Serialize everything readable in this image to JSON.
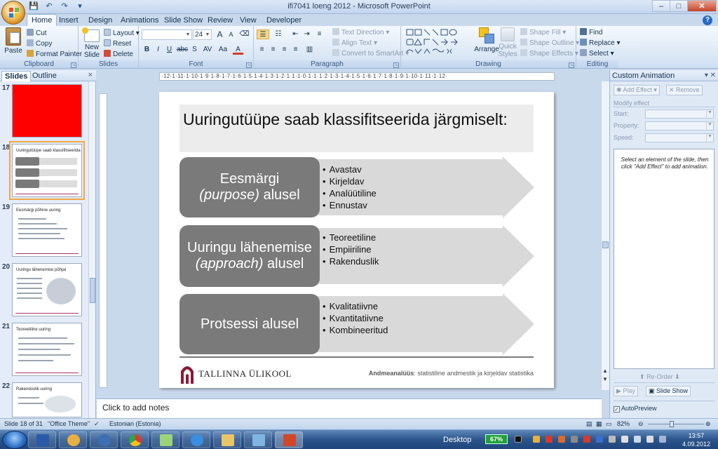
{
  "window": {
    "title": "ifi7041 loeng 2012 - Microsoft PowerPoint",
    "min": "–",
    "max": "□",
    "close": "✕"
  },
  "qat": {
    "save": "💾",
    "undo": "↶",
    "redo": "↷",
    "more": "▾"
  },
  "tabs": [
    "Home",
    "Insert",
    "Design",
    "Animations",
    "Slide Show",
    "Review",
    "View",
    "Developer"
  ],
  "active_tab": "Home",
  "ribbon": {
    "clipboard": {
      "label": "Clipboard",
      "paste": "Paste",
      "cut": "Cut",
      "copy": "Copy",
      "format_painter": "Format Painter"
    },
    "slides": {
      "label": "Slides",
      "new_slide": "New Slide",
      "layout": "Layout",
      "reset": "Reset",
      "delete": "Delete"
    },
    "font": {
      "label": "Font",
      "font_name": "",
      "font_size": "24",
      "grow": "A",
      "shrink": "A",
      "clear": "⌫",
      "bold": "B",
      "italic": "I",
      "underline": "U",
      "strike": "abc",
      "shadow": "S",
      "spacing": "AV",
      "case": "Aa",
      "color": "A"
    },
    "paragraph": {
      "label": "Paragraph",
      "text_direction": "Text Direction",
      "align_text": "Align Text",
      "convert_smartart": "Convert to SmartArt"
    },
    "drawing": {
      "label": "Drawing",
      "arrange": "Arrange",
      "quick_styles": "Quick Styles",
      "shape_fill": "Shape Fill",
      "shape_outline": "Shape Outline",
      "shape_effects": "Shape Effects"
    },
    "editing": {
      "label": "Editing",
      "find": "Find",
      "replace": "Replace",
      "select": "Select"
    }
  },
  "left_panel": {
    "tabs": [
      "Slides",
      "Outline"
    ],
    "close": "×",
    "thumbnails": [
      {
        "num": "17",
        "title": ""
      },
      {
        "num": "18",
        "title": "Uuringutüüpe saab klassifitseerida"
      },
      {
        "num": "19",
        "title": "Eesmärgi põhine uuring"
      },
      {
        "num": "20",
        "title": "Uuringu lähenemise põhjal"
      },
      {
        "num": "21",
        "title": "Teoreetiline uuring"
      },
      {
        "num": "22",
        "title": "Rakenduslik uuring"
      }
    ]
  },
  "ruler": {
    "h": "·12·1·11·1·10·1·9·1·8·1·7·1·6·1·5·1·4·1·3·1·2·1·1·1·0·1·1·1·2·1·3·1·4·1·5·1·6·1·7·1·8·1·9·1·10·1·11·1·12·"
  },
  "slide": {
    "title": "Uuringutüüpe saab klassifitseerida järgmiselt:",
    "rows": [
      {
        "label_pre": "Eesmärgi",
        "label_it": "(purpose)",
        "label_post": "alusel",
        "bullets": [
          "Avastav",
          "Kirjeldav",
          "Analüütiline",
          "Ennustav"
        ]
      },
      {
        "label_pre": "Uuringu lähenemise",
        "label_it": "(approach)",
        "label_post": "alusel",
        "bullets": [
          "Teoreetiline",
          "Empiiriline",
          "Rakenduslik"
        ]
      },
      {
        "label_pre": "Protsessi alusel",
        "label_it": "",
        "label_post": "",
        "bullets": [
          "Kvalitatiivne",
          "Kvantitatiivne",
          "Kombineeritud"
        ]
      }
    ],
    "logo_text": "TALLINNA ÜLIKOOL",
    "footer_bold": "Andmeanalüüs",
    "footer_rest": ": statistiline andmestik ja kirjeldav statistika"
  },
  "notes": {
    "placeholder": "Click to add notes"
  },
  "task_pane": {
    "title": "Custom Animation",
    "add_effect": "Add Effect",
    "remove": "Remove",
    "modify": "Modify effect",
    "start": "Start:",
    "property": "Property:",
    "speed": "Speed:",
    "hint": "Select an element of the slide, then click \"Add Effect\" to add animation.",
    "reorder": "Re-Order",
    "play": "Play",
    "slide_show": "Slide Show",
    "autopreview": "AutoPreview"
  },
  "status": {
    "slide": "Slide 18 of 31",
    "theme": "\"Office Theme\"",
    "language": "Estonian (Estonia)",
    "zoom": "82%"
  },
  "taskbar": {
    "desktop": "Desktop",
    "battery": "67%",
    "time": "13:57",
    "date": "4.09.2012"
  },
  "colors": {
    "shape_gray": "#7a7a7a",
    "arrow_gray": "#d9d9d9",
    "title_bg": "#ececec",
    "logo": "#8b1a3a"
  }
}
